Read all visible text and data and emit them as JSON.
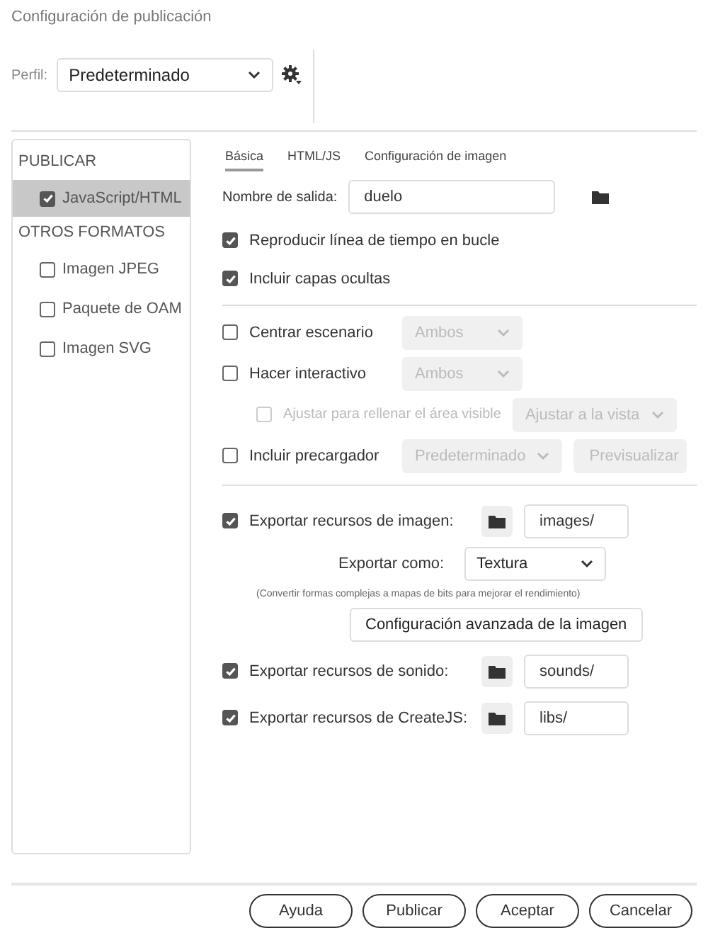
{
  "window": {
    "title": "Configuración de publicación"
  },
  "profile": {
    "label": "Perfil:",
    "value": "Predeterminado"
  },
  "sidebar": {
    "sections": [
      {
        "heading": "PUBLICAR",
        "items": [
          {
            "label": "JavaScript/HTML",
            "checked": true,
            "selected": true
          }
        ]
      },
      {
        "heading": "OTROS FORMATOS",
        "items": [
          {
            "label": "Imagen JPEG",
            "checked": false,
            "selected": false
          },
          {
            "label": "Paquete de OAM",
            "checked": false,
            "selected": false
          },
          {
            "label": "Imagen SVG",
            "checked": false,
            "selected": false
          }
        ]
      }
    ]
  },
  "tabs": [
    {
      "label": "Básica",
      "selected": true
    },
    {
      "label": "HTML/JS",
      "selected": false
    },
    {
      "label": "Configuración de imagen",
      "selected": false
    }
  ],
  "output": {
    "label": "Nombre de salida:",
    "value": "duelo"
  },
  "options": [
    {
      "label": "Reproducir línea de tiempo en bucle",
      "checked": true
    },
    {
      "label": "Incluir capas ocultas",
      "checked": true
    }
  ],
  "stage_options": [
    {
      "label": "Centrar escenario",
      "checked": false,
      "disabled": false,
      "controls": [
        {
          "kind": "select",
          "value": "Ambos",
          "disabled": true
        }
      ]
    },
    {
      "label": "Hacer interactivo",
      "checked": false,
      "disabled": false,
      "controls": [
        {
          "kind": "select",
          "value": "Ambos",
          "disabled": true
        }
      ],
      "children": [
        {
          "label": "Ajustar para rellenar el área visible",
          "checked": false,
          "disabled": true,
          "controls": [
            {
              "kind": "select",
              "value": "Ajustar a la vista",
              "disabled": true
            }
          ]
        }
      ]
    },
    {
      "label": "Incluir precargador",
      "checked": false,
      "disabled": false,
      "controls": [
        {
          "kind": "select",
          "value": "Predeterminado",
          "disabled": true
        },
        {
          "kind": "button",
          "label": "Previsualizar",
          "disabled": true
        }
      ]
    }
  ],
  "image_assets": {
    "label": "Exportar recursos de imagen:",
    "checked": true,
    "path": "images/"
  },
  "export_as": {
    "label": "Exportar como:",
    "value": "Textura"
  },
  "note": "(Convertir formas complejas a mapas de bits para mejorar el rendimiento)",
  "advanced_button": "Configuración avanzada de la imagen",
  "other_assets": [
    {
      "label": "Exportar recursos de sonido:",
      "checked": true,
      "path": "sounds/"
    },
    {
      "label": "Exportar recursos de CreateJS:",
      "checked": true,
      "path": "libs/"
    }
  ],
  "buttons": [
    "Ayuda",
    "Publicar",
    "Aceptar",
    "Cancelar"
  ]
}
